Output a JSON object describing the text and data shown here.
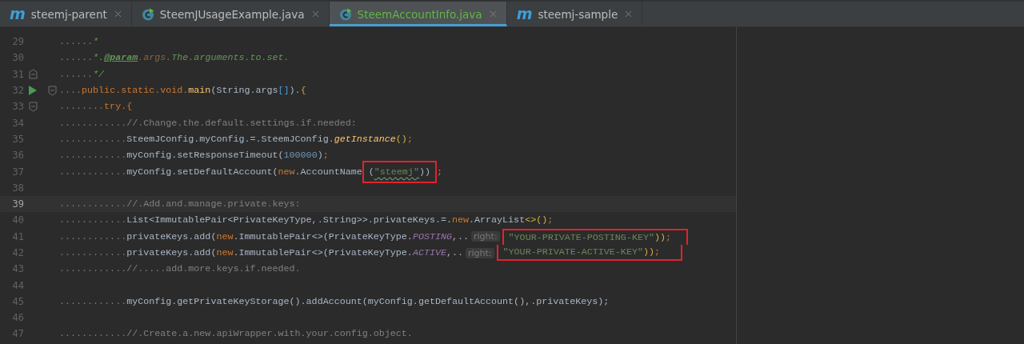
{
  "tabs": [
    {
      "label": "steemj-parent",
      "kind": "module",
      "glyph": "m",
      "selected": false
    },
    {
      "label": "SteemJUsageExample.java",
      "kind": "class",
      "selected": false
    },
    {
      "label": "SteemAccountInfo.java",
      "kind": "class",
      "selected": true
    },
    {
      "label": "steemj-sample",
      "kind": "module",
      "glyph": "m",
      "selected": false
    }
  ],
  "lines": [
    {
      "number": "29",
      "current": false,
      "segments": [
        {
          "kind": "ws",
          "text": "......"
        },
        {
          "kind": "doc",
          "text": "*"
        }
      ]
    },
    {
      "number": "30",
      "current": false,
      "segments": [
        {
          "kind": "ws",
          "text": "......"
        },
        {
          "kind": "doc",
          "text": "*."
        },
        {
          "kind": "doctag",
          "text": "@param"
        },
        {
          "kind": "docparam",
          "text": ".args"
        },
        {
          "kind": "doc",
          "text": ".The.arguments.to.set."
        }
      ]
    },
    {
      "number": "31",
      "current": false,
      "markers": [
        {
          "kind": "fold-end"
        }
      ],
      "segments": [
        {
          "kind": "ws",
          "text": "......"
        },
        {
          "kind": "doc",
          "text": "*/"
        }
      ]
    },
    {
      "number": "32",
      "current": false,
      "markers": [
        {
          "kind": "run"
        },
        {
          "kind": "fold-start"
        }
      ],
      "segments": [
        {
          "kind": "ws",
          "text": "...."
        },
        {
          "kind": "keyword",
          "text": "public.static.void."
        },
        {
          "kind": "declaration",
          "text": "main"
        },
        {
          "kind": "plain",
          "text": "(String.args"
        },
        {
          "kind": "bracket",
          "text": "[]"
        },
        {
          "kind": "plain",
          "text": ")."
        },
        {
          "kind": "brace",
          "text": "{"
        }
      ]
    },
    {
      "number": "33",
      "current": false,
      "markers": [
        {
          "kind": "fold-start"
        }
      ],
      "segments": [
        {
          "kind": "ws",
          "text": "........"
        },
        {
          "kind": "keyword",
          "text": "try.{"
        }
      ]
    },
    {
      "number": "34",
      "current": false,
      "segments": [
        {
          "kind": "ws",
          "text": "............"
        },
        {
          "kind": "comment",
          "text": "//.Change.the.default.settings.if.needed:"
        }
      ]
    },
    {
      "number": "35",
      "current": false,
      "segments": [
        {
          "kind": "ws",
          "text": "............"
        },
        {
          "kind": "plain",
          "text": "SteemJConfig.myConfig.=.SteemJConfig."
        },
        {
          "kind": "static",
          "text": "getInstance"
        },
        {
          "kind": "paren",
          "text": "()"
        },
        {
          "kind": "keyword",
          "text": ";"
        }
      ]
    },
    {
      "number": "36",
      "current": false,
      "segments": [
        {
          "kind": "ws",
          "text": "............"
        },
        {
          "kind": "plain",
          "text": "myConfig.setResponseTimeout("
        },
        {
          "kind": "number",
          "text": "100000"
        },
        {
          "kind": "plain",
          "text": ")"
        },
        {
          "kind": "keyword",
          "text": ";"
        }
      ]
    },
    {
      "number": "37",
      "current": false,
      "segments": [
        {
          "kind": "ws",
          "text": "............"
        },
        {
          "kind": "plain",
          "text": "myConfig.setDefaultAccount("
        },
        {
          "kind": "keyword",
          "text": "new"
        },
        {
          "kind": "plain",
          "text": ".AccountName"
        },
        {
          "kind": "box",
          "segments": [
            {
              "kind": "plain",
              "text": "("
            },
            {
              "kind": "string",
              "text": "\"steemj\"",
              "typo": true
            },
            {
              "kind": "plain",
              "text": "))"
            }
          ]
        },
        {
          "kind": "keyword",
          "text": ";"
        }
      ]
    },
    {
      "number": "38",
      "current": false
    },
    {
      "number": "39",
      "current": true,
      "segments": [
        {
          "kind": "ws",
          "text": "............"
        },
        {
          "kind": "comment",
          "text": "//.Add.and.manage.private.keys:"
        }
      ]
    },
    {
      "number": "40",
      "current": false,
      "segments": [
        {
          "kind": "ws",
          "text": "............"
        },
        {
          "kind": "plain",
          "text": "List<ImmutablePair<PrivateKeyType,.String>>.privateKeys.=."
        },
        {
          "kind": "keyword",
          "text": "new"
        },
        {
          "kind": "plain",
          "text": ".ArrayList"
        },
        {
          "kind": "paren",
          "text": "<>()"
        },
        {
          "kind": "keyword",
          "text": ";"
        }
      ]
    },
    {
      "number": "41",
      "current": false,
      "segments": [
        {
          "kind": "ws",
          "text": "............"
        },
        {
          "kind": "plain",
          "text": "privateKeys.add("
        },
        {
          "kind": "keyword",
          "text": "new"
        },
        {
          "kind": "plain",
          "text": ".ImmutablePair<>(PrivateKeyType."
        },
        {
          "kind": "constant",
          "text": "POSTING"
        },
        {
          "kind": "plain",
          "text": ",.."
        },
        {
          "kind": "hint",
          "text": "right:"
        },
        {
          "kind": "box-top",
          "segments": [
            {
              "kind": "string",
              "text": "\"YOUR-PRIVATE-POSTING-KEY\"",
              "typo": false
            },
            {
              "kind": "paren",
              "text": "))"
            },
            {
              "kind": "keyword",
              "text": ";"
            }
          ]
        }
      ]
    },
    {
      "number": "42",
      "current": false,
      "segments": [
        {
          "kind": "ws",
          "text": "............"
        },
        {
          "kind": "plain",
          "text": "privateKeys.add("
        },
        {
          "kind": "keyword",
          "text": "new"
        },
        {
          "kind": "plain",
          "text": ".ImmutablePair<>(PrivateKeyType."
        },
        {
          "kind": "constant",
          "text": "ACTIVE"
        },
        {
          "kind": "plain",
          "text": ",.."
        },
        {
          "kind": "hint",
          "text": "right:"
        },
        {
          "kind": "box-bottom",
          "segments": [
            {
              "kind": "string",
              "text": "\"YOUR-PRIVATE-ACTIVE-KEY\"",
              "typo": false
            },
            {
              "kind": "paren",
              "text": "))"
            },
            {
              "kind": "keyword",
              "text": ";"
            }
          ]
        }
      ]
    },
    {
      "number": "43",
      "current": false,
      "segments": [
        {
          "kind": "ws",
          "text": "............"
        },
        {
          "kind": "comment",
          "text": "//.....add.more.keys.if.needed."
        }
      ]
    },
    {
      "number": "44",
      "current": false
    },
    {
      "number": "45",
      "current": false,
      "segments": [
        {
          "kind": "ws",
          "text": "............"
        },
        {
          "kind": "plain",
          "text": "myConfig.getPrivateKeyStorage().addAccount(myConfig.getDefaultAccount(),.privateKeys);"
        }
      ]
    },
    {
      "number": "46",
      "current": false
    },
    {
      "number": "47",
      "current": false,
      "segments": [
        {
          "kind": "ws",
          "text": "............"
        },
        {
          "kind": "comment",
          "text": "//.Create.a.new.apiWrapper.with.your.config.object."
        }
      ]
    }
  ]
}
